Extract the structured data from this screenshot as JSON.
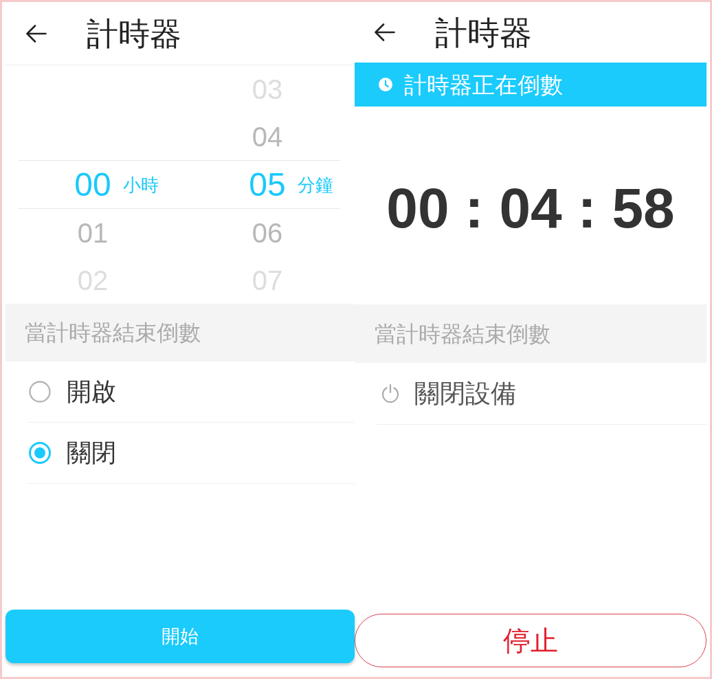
{
  "setup_screen": {
    "app_bar": {
      "title": "計時器"
    },
    "picker": {
      "columns": [
        {
          "unit": "小時",
          "items": [
            {
              "value": "00",
              "selected": true
            },
            {
              "value": "01",
              "selected": false
            },
            {
              "value": "02",
              "selected": false
            }
          ]
        },
        {
          "unit": "分鐘",
          "items": [
            {
              "value": "03",
              "selected": false
            },
            {
              "value": "04",
              "selected": false
            },
            {
              "value": "05",
              "selected": true
            },
            {
              "value": "06",
              "selected": false
            },
            {
              "value": "07",
              "selected": false
            }
          ]
        }
      ]
    },
    "end_section": {
      "header": "當計時器結束倒數",
      "options": [
        {
          "label": "開啟",
          "selected": false
        },
        {
          "label": "關閉",
          "selected": true
        }
      ]
    },
    "start_button": {
      "label": "開始"
    }
  },
  "running_screen": {
    "app_bar": {
      "title": "計時器"
    },
    "banner": {
      "text": "計時器正在倒數"
    },
    "countdown": "00 : 04 : 58",
    "end_section": {
      "header": "當計時器結束倒數",
      "action": {
        "label": "關閉設備"
      }
    },
    "stop_button": {
      "label": "停止"
    }
  }
}
